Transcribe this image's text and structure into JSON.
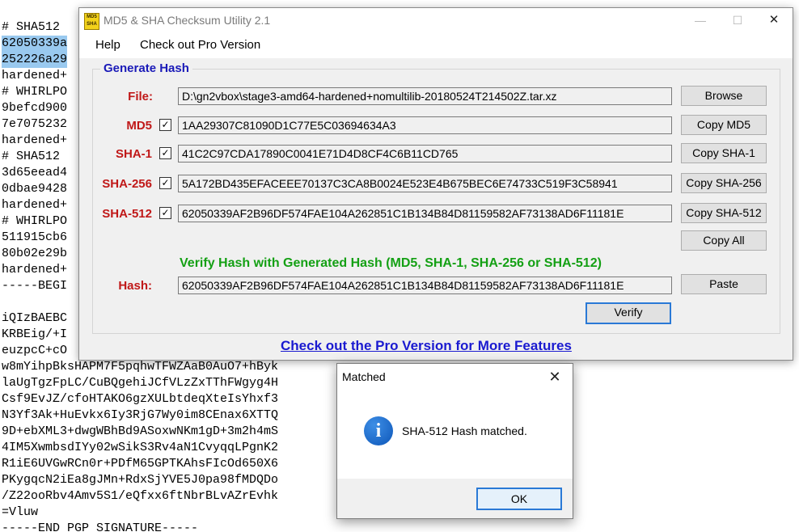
{
  "background_text": [
    {
      "text": "# SHA512",
      "selected": false
    },
    {
      "text": "62050339a",
      "selected": true
    },
    {
      "text": "252226a29",
      "selected": true
    },
    {
      "text": "hardened+",
      "selected": false
    },
    {
      "text": "# WHIRLPO",
      "selected": false
    },
    {
      "text": "9befcd900",
      "selected": false
    },
    {
      "text": "7e7075232",
      "selected": false
    },
    {
      "text": "hardened+",
      "selected": false
    },
    {
      "text": "# SHA512",
      "selected": false
    },
    {
      "text": "3d65eead4",
      "selected": false
    },
    {
      "text": "0dbae9428",
      "selected": false
    },
    {
      "text": "hardened+",
      "selected": false
    },
    {
      "text": "# WHIRLPO",
      "selected": false
    },
    {
      "text": "511915cb6",
      "selected": false
    },
    {
      "text": "80b02e29b",
      "selected": false
    },
    {
      "text": "hardened+",
      "selected": false
    },
    {
      "text": "-----BEGI",
      "selected": false
    },
    {
      "text": "",
      "selected": false
    },
    {
      "text": "iQIzBAEBC",
      "selected": false
    },
    {
      "text": "KRBEig/+I",
      "selected": false
    },
    {
      "text": "euzpcC+cO",
      "selected": false
    },
    {
      "text": "w8mYihpBksHAPM7F5pqhwTFWZAaB0AuO7+hByk",
      "selected": false
    },
    {
      "text": "laUgTgzFpLC/CuBQgehiJCfVLzZxTThFWgyg4H",
      "selected": false
    },
    {
      "text": "Csf9EvJZ/cfoHTAKO6gzXULbtdeqXteIsYhxf3",
      "selected": false
    },
    {
      "text": "N3Yf3Ak+HuEvkx6Iy3RjG7Wy0im8CEnax6XTTQ",
      "selected": false
    },
    {
      "text": "9D+ebXML3+dwgWBhBd9ASoxwNKm1gD+3m2h4mS",
      "selected": false
    },
    {
      "text": "4IM5XwmbsdIYy02wSikS3Rv4aN1CvyqqLPgnK2",
      "selected": false
    },
    {
      "text": "R1iE6UVGwRCn0r+PDfM65GPTKAhsFIcOd650X6",
      "selected": false
    },
    {
      "text": "PKygqcN2iEa8gJMn+RdxSjYVE5J0pa98fMDQDo",
      "selected": false
    },
    {
      "text": "/Z22ooRbv4Amv5S1/eQfxx6ftNbrBLvAZrEvhk",
      "selected": false
    },
    {
      "text": "=Vluw",
      "selected": false
    },
    {
      "text": "-----END PGP SIGNATURE-----",
      "selected": false
    }
  ],
  "window": {
    "title": "MD5 & SHA Checksum Utility 2.1",
    "icon_text_top": "MD5",
    "icon_text_bottom": "SHA",
    "minimize_glyph": "—",
    "maximize_glyph": "☐",
    "close_glyph": "✕"
  },
  "menu": {
    "help": "Help",
    "pro": "Check out Pro Version"
  },
  "generate": {
    "group_title": "Generate Hash",
    "file_label": "File:",
    "file_value": "D:\\gn2vbox\\stage3-amd64-hardened+nomultilib-20180524T214502Z.tar.xz",
    "browse_label": "Browse",
    "rows": [
      {
        "label": "MD5",
        "checked": "✓",
        "value": "1AA29307C81090D1C77E5C03694634A3",
        "button": "Copy MD5"
      },
      {
        "label": "SHA-1",
        "checked": "✓",
        "value": "41C2C97CDA17890C0041E71D4D8CF4C6B11CD765",
        "button": "Copy SHA-1"
      },
      {
        "label": "SHA-256",
        "checked": "✓",
        "value": "5A172BD435EFACEEE70137C3CA8B0024E523E4B675BEC6E74733C519F3C58941",
        "button": "Copy SHA-256"
      },
      {
        "label": "SHA-512",
        "checked": "✓",
        "value": "62050339AF2B96DF574FAE104A262851C1B134B84D81159582AF73138AD6F11181E",
        "button": "Copy SHA-512"
      }
    ],
    "copy_all_label": "Copy All"
  },
  "verify": {
    "heading": "Verify Hash with Generated Hash (MD5, SHA-1, SHA-256 or SHA-512)",
    "hash_label": "Hash:",
    "hash_value": "62050339AF2B96DF574FAE104A262851C1B134B84D81159582AF73138AD6F11181E",
    "paste_label": "Paste",
    "verify_label": "Verify"
  },
  "pro_link": "Check out the Pro Version for More Features",
  "dialog": {
    "title": "Matched",
    "close_glyph": "✕",
    "icon_glyph": "i",
    "message": "SHA-512 Hash matched.",
    "ok_label": "OK"
  },
  "colors": {
    "label_red": "#c01818",
    "group_title_blue": "#1a1ab8",
    "verify_green": "#14a014",
    "link_blue": "#1a1ad0",
    "selection": "#99c9ef",
    "info_blue": "#0d56b8"
  }
}
